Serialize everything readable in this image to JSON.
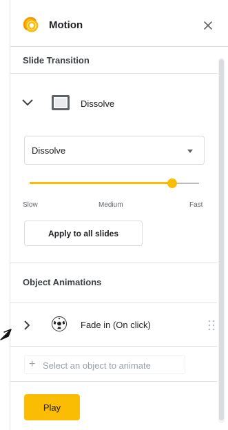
{
  "header": {
    "title": "Motion",
    "logo_icon": "motion-icon",
    "close_icon": "close-icon"
  },
  "transition": {
    "section_title": "Slide Transition",
    "current": "Dissolve",
    "dropdown_value": "Dissolve",
    "speed": {
      "slow": "Slow",
      "medium": "Medium",
      "fast": "Fast",
      "level_fraction": 0.84
    },
    "apply_label": "Apply to all slides"
  },
  "animations": {
    "section_title": "Object Animations",
    "items": [
      {
        "label": "Fade in  (On click)",
        "icon": "soccer-ball-icon"
      }
    ],
    "add_label": "Select an object to animate"
  },
  "play_label": "Play",
  "colors": {
    "accent": "#fbbc04",
    "divider": "#e0e0e0"
  }
}
